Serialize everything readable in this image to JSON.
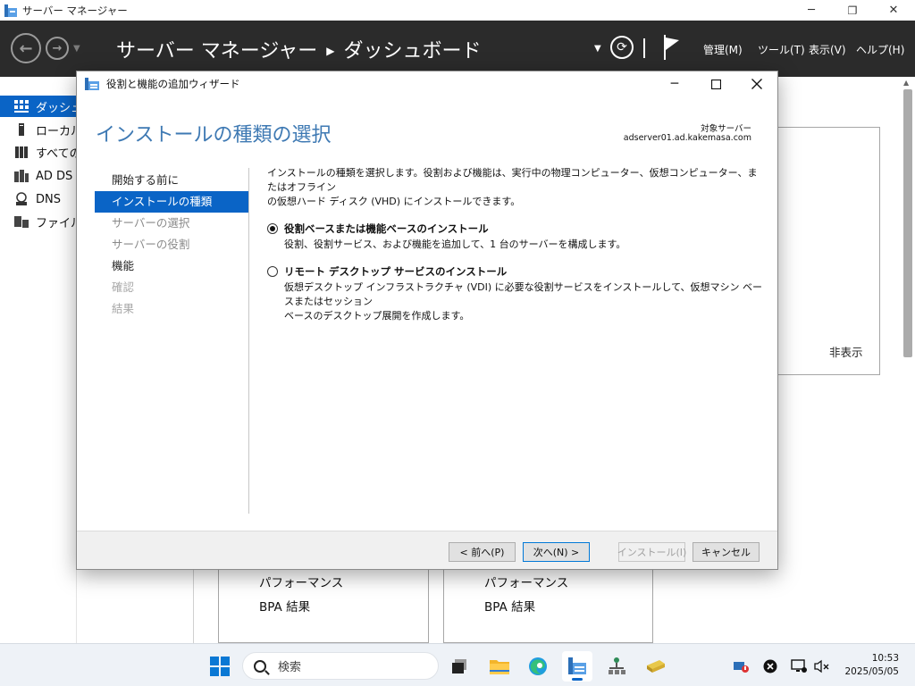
{
  "app": {
    "title": "サーバー マネージャー",
    "window_controls": {
      "minimize": "─",
      "maximize": "❐",
      "close": "✕"
    }
  },
  "header": {
    "back_icon": "back-arrow-icon",
    "forward_icon": "forward-arrow-icon",
    "breadcrumb_root": "サーバー マネージャー",
    "breadcrumb_sep": "▶",
    "breadcrumb_current": "ダッシュボード",
    "refresh_glyph": "⟳",
    "menu": [
      "管理(M)",
      "ツール(T)",
      "表示(V)",
      "ヘルプ(H)"
    ]
  },
  "sidebar": {
    "items": [
      {
        "label": "ダッシュボード",
        "icon": "dashboard-icon",
        "active": true
      },
      {
        "label": "ローカル サーバー",
        "icon": "local-server-icon",
        "active": false
      },
      {
        "label": "すべてのサーバー",
        "icon": "all-servers-icon",
        "active": false
      },
      {
        "label": "AD DS",
        "icon": "ad-ds-icon",
        "active": false
      },
      {
        "label": "DNS",
        "icon": "dns-icon",
        "active": false
      },
      {
        "label": "ファイル サービスと記憶域サービス",
        "icon": "file-services-icon",
        "active": false
      }
    ]
  },
  "dashboard": {
    "hide_label": "非表示",
    "tiles": [
      {
        "perf": "パフォーマンス",
        "bpa": "BPA 結果"
      },
      {
        "perf": "パフォーマンス",
        "bpa": "BPA 結果"
      }
    ]
  },
  "wizard": {
    "title": "役割と機能の追加ウィザード",
    "heading": "インストールの種類の選択",
    "target_label": "対象サーバー",
    "target_value": "adserver01.ad.kakemasa.com",
    "steps": [
      {
        "label": "開始する前に",
        "state": "done"
      },
      {
        "label": "インストールの種類",
        "state": "active"
      },
      {
        "label": "サーバーの選択",
        "state": "future"
      },
      {
        "label": "サーバーの役割",
        "state": "future"
      },
      {
        "label": "機能",
        "state": "done"
      },
      {
        "label": "確認",
        "state": "disabled"
      },
      {
        "label": "結果",
        "state": "disabled"
      }
    ],
    "description_line1": "インストールの種類を選択します。役割および機能は、実行中の物理コンピューター、仮想コンピューター、またはオフライン",
    "description_line2": "の仮想ハード ディスク (VHD) にインストールできます。",
    "options": [
      {
        "title": "役割ベースまたは機能ベースのインストール",
        "desc_line1": "役割、役割サービス、および機能を追加して、1 台のサーバーを構成します。",
        "desc_line2": "",
        "selected": true
      },
      {
        "title": "リモート デスクトップ サービスのインストール",
        "desc_line1": "仮想デスクトップ インフラストラクチャ (VDI) に必要な役割サービスをインストールして、仮想マシン ベースまたはセッション",
        "desc_line2": "ベースのデスクトップ展開を作成します。",
        "selected": false
      }
    ],
    "buttons": {
      "prev": "< 前へ(P)",
      "next": "次へ(N) >",
      "install": "インストール(I)",
      "cancel": "キャンセル"
    }
  },
  "taskbar": {
    "search_placeholder": "検索",
    "apps": [
      "task-view-icon",
      "file-explorer-icon",
      "edge-icon",
      "server-manager-icon",
      "network-icon",
      "notepad-icon"
    ],
    "tray": [
      "network-warning-icon",
      "close-circle-icon",
      "display-icon",
      "speaker-muted-icon"
    ],
    "time": "10:53",
    "date": "2025/05/05"
  },
  "colors": {
    "accent": "#0a64c6",
    "header_bg": "#2b2b2b",
    "heading_blue": "#3e79b3"
  }
}
